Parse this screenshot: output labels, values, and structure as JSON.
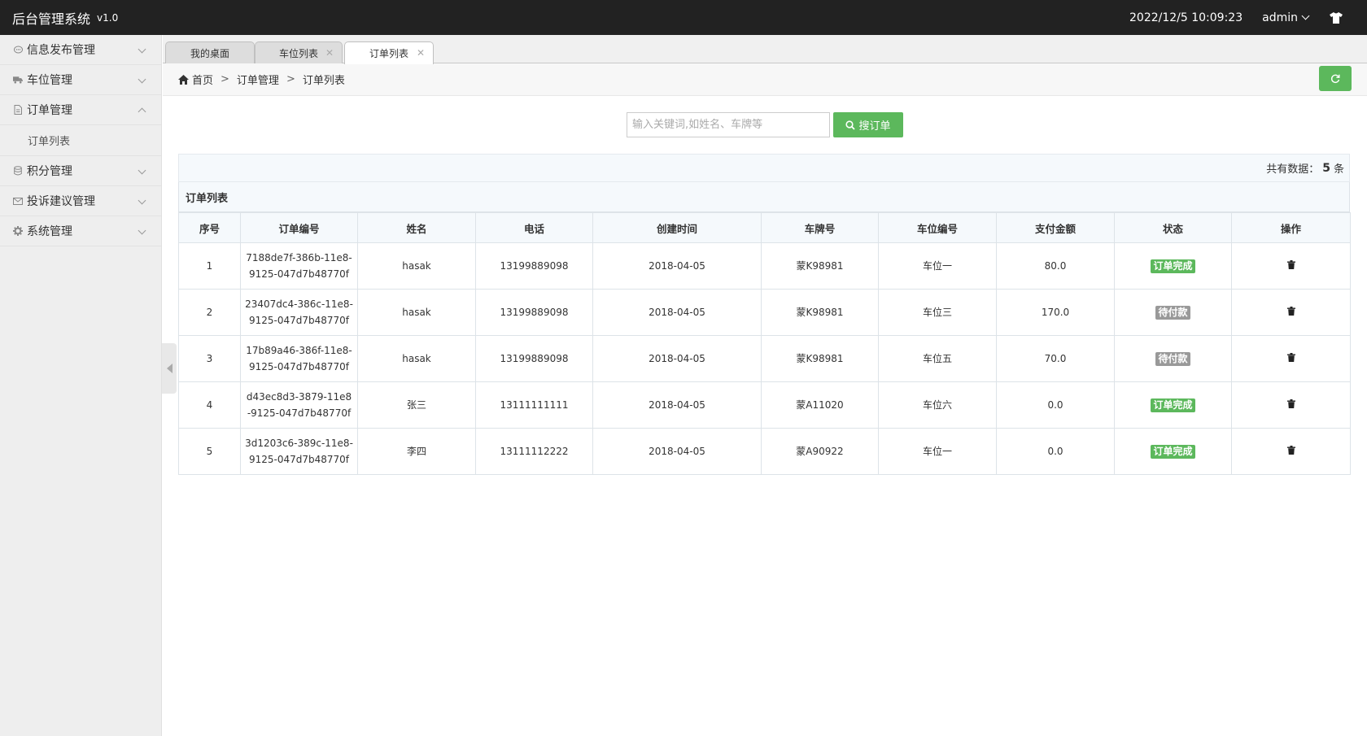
{
  "header": {
    "brand": "后台管理系统",
    "version": "v1.0",
    "datetime": "2022/12/5 10:09:23",
    "user": "admin"
  },
  "sidebar": {
    "items": [
      {
        "label": "信息发布管理",
        "icon": "comment-icon",
        "expanded": false
      },
      {
        "label": "车位管理",
        "icon": "truck-icon",
        "expanded": false
      },
      {
        "label": "订单管理",
        "icon": "document-icon",
        "expanded": true
      },
      {
        "label": "积分管理",
        "icon": "database-icon",
        "expanded": false
      },
      {
        "label": "投诉建议管理",
        "icon": "envelope-icon",
        "expanded": false
      },
      {
        "label": "系统管理",
        "icon": "gear-icon",
        "expanded": false
      }
    ],
    "subitems": {
      "order": "订单列表"
    }
  },
  "tabs": [
    {
      "label": "我的桌面",
      "closable": false
    },
    {
      "label": "车位列表",
      "closable": true
    },
    {
      "label": "订单列表",
      "closable": true,
      "active": true
    }
  ],
  "breadcrumb": [
    "首页",
    "订单管理",
    "订单列表"
  ],
  "search": {
    "placeholder": "输入关键词,如姓名、车牌等",
    "button": "搜订单"
  },
  "summary": {
    "prefix": "共有数据：",
    "count": "5",
    "suffix": "条"
  },
  "table": {
    "caption": "订单列表",
    "headers": [
      "序号",
      "订单编号",
      "姓名",
      "电话",
      "创建时间",
      "车牌号",
      "车位编号",
      "支付金额",
      "状态",
      "操作"
    ],
    "rows": [
      {
        "idx": "1",
        "order_no_1": "7188de7f-386b-11e8-",
        "order_no_2": "9125-047d7b48770f",
        "name": "hasak",
        "phone": "13199889098",
        "created": "2018-04-05",
        "plate": "蒙K98981",
        "slot": "车位一",
        "amount": "80.0",
        "status": "订单完成",
        "status_color": "#5cb85c"
      },
      {
        "idx": "2",
        "order_no_1": "23407dc4-386c-11e8-",
        "order_no_2": "9125-047d7b48770f",
        "name": "hasak",
        "phone": "13199889098",
        "created": "2018-04-05",
        "plate": "蒙K98981",
        "slot": "车位三",
        "amount": "170.0",
        "status": "待付款",
        "status_color": "#999999"
      },
      {
        "idx": "3",
        "order_no_1": "17b89a46-386f-11e8-",
        "order_no_2": "9125-047d7b48770f",
        "name": "hasak",
        "phone": "13199889098",
        "created": "2018-04-05",
        "plate": "蒙K98981",
        "slot": "车位五",
        "amount": "70.0",
        "status": "待付款",
        "status_color": "#999999"
      },
      {
        "idx": "4",
        "order_no_1": "d43ec8d3-3879-11e8",
        "order_no_2": "-9125-047d7b48770f",
        "name": "张三",
        "phone": "13111111111",
        "created": "2018-04-05",
        "plate": "蒙A11020",
        "slot": "车位六",
        "amount": "0.0",
        "status": "订单完成",
        "status_color": "#5cb85c"
      },
      {
        "idx": "5",
        "order_no_1": "3d1203c6-389c-11e8-",
        "order_no_2": "9125-047d7b48770f",
        "name": "李四",
        "phone": "13111112222",
        "created": "2018-04-05",
        "plate": "蒙A90922",
        "slot": "车位一",
        "amount": "0.0",
        "status": "订单完成",
        "status_color": "#5cb85c"
      }
    ]
  }
}
